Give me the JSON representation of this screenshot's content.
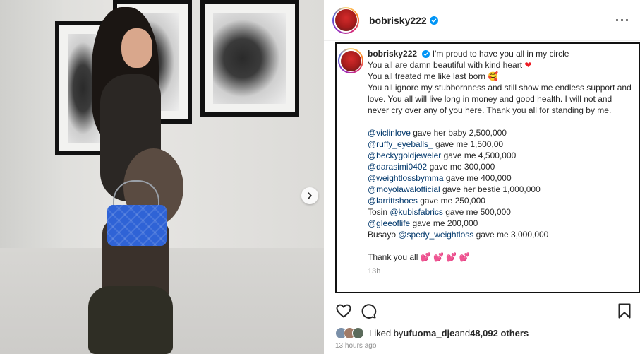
{
  "post": {
    "username": "bobrisky222",
    "verified_icon": "verified-badge-icon",
    "more_icon": "more-options-icon"
  },
  "caption": {
    "username": "bobrisky222",
    "line1": "I'm proud to have you all in my circle",
    "line2": "You all are damn beautiful with kind heart",
    "line2_emoji": "❤",
    "line3": "You all treated me like last born",
    "line3_emoji": "🥰",
    "line4": "You all ignore my stubbornness and still show me endless support and love. You all will live long in money and good health. I will not and never cry over any of you here. Thank you all for standing by me.",
    "gifts": [
      {
        "prefix": "",
        "handle": "@viclinlove",
        "text": " gave her baby 2,500,000"
      },
      {
        "prefix": "",
        "handle": "@ruffy_eyeballs_",
        "text": " gave me 1,500,00"
      },
      {
        "prefix": "",
        "handle": "@beckygoldjeweler",
        "text": " gave me 4,500,000"
      },
      {
        "prefix": "",
        "handle": "@darasimi0402",
        "text": " gave me 300,000"
      },
      {
        "prefix": "",
        "handle": "@weightlossbymma",
        "text": " gave me 400,000"
      },
      {
        "prefix": "",
        "handle": "@moyolawalofficial",
        "text": " gave her bestie 1,000,000"
      },
      {
        "prefix": "",
        "handle": "@larrittshoes",
        "text": " gave me 250,000"
      },
      {
        "prefix": "Tosin ",
        "handle": "@kubisfabrics",
        "text": " gave me 500,000"
      },
      {
        "prefix": "",
        "handle": "@gleeoflife",
        "text": " gave me 200,000"
      },
      {
        "prefix": "Busayo ",
        "handle": "@spedy_weightloss",
        "text": " gave me 3,000,000"
      }
    ],
    "thanks": "Thank you all",
    "thanks_emoji": "💕 💕 💕 💕",
    "time": "13h"
  },
  "actions": {
    "like_icon": "heart-icon",
    "comment_icon": "comment-icon",
    "save_icon": "bookmark-icon"
  },
  "likes": {
    "prefix": "Liked by ",
    "user": "ufuoma_dje",
    "middle": " and ",
    "count": "48,092 others"
  },
  "timestamp": "13 hours ago",
  "carousel": {
    "next_icon": "chevron-right-icon"
  },
  "colors": {
    "link": "#00376b",
    "verified": "#0095f6",
    "heart": "#ed1c24",
    "bag": "#2f63d6"
  }
}
